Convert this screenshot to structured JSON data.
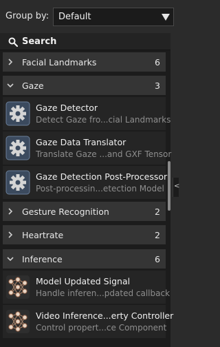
{
  "group_by": {
    "label": "Group by:",
    "value": "Default"
  },
  "search": {
    "label": "Search"
  },
  "categories": [
    {
      "label": "Facial Landmarks",
      "count": "6",
      "expanded": false
    },
    {
      "label": "Gaze",
      "count": "3",
      "expanded": true
    },
    {
      "label": "Gesture Recognition",
      "count": "2",
      "expanded": false
    },
    {
      "label": "Heartrate",
      "count": "2",
      "expanded": false
    },
    {
      "label": "Inference",
      "count": "6",
      "expanded": true
    }
  ],
  "gaze_items": [
    {
      "title": "Gaze Detector",
      "desc": "Detect Gaze fro...cial Landmarks",
      "icon": "gear-icon"
    },
    {
      "title": "Gaze Data Translator",
      "desc": "Translate Gaze ...and GXF Tensor",
      "icon": "gear-icon"
    },
    {
      "title": "Gaze Detection Post-Processor",
      "desc": "Post-processin...etection Model",
      "icon": "gear-icon"
    }
  ],
  "inference_items": [
    {
      "title": "Model Updated Signal",
      "desc": "Handle inferen...pdated callback",
      "icon": "neural-network-icon"
    },
    {
      "title": "Video Inference...erty Controller",
      "desc": "Control propert...ce Component",
      "icon": "neural-network-icon"
    }
  ],
  "collapse_glyph": "<"
}
